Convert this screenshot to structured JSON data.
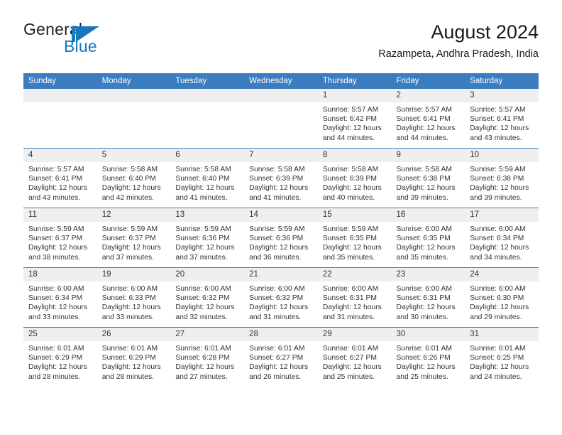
{
  "brand": {
    "name_part1": "General",
    "name_part2": "Blue",
    "mark": "flag-triangle-icon",
    "accent_color": "#1878be"
  },
  "header": {
    "title": "August 2024",
    "location": "Razampeta, Andhra Pradesh, India",
    "header_bg_color": "#3b7dbf",
    "daynum_bg_color": "#efefef"
  },
  "weekdays": [
    "Sunday",
    "Monday",
    "Tuesday",
    "Wednesday",
    "Thursday",
    "Friday",
    "Saturday"
  ],
  "weeks": [
    [
      {
        "day": "",
        "empty": true,
        "sunrise": "",
        "sunset": "",
        "daylight1": "",
        "daylight2": ""
      },
      {
        "day": "",
        "empty": true,
        "sunrise": "",
        "sunset": "",
        "daylight1": "",
        "daylight2": ""
      },
      {
        "day": "",
        "empty": true,
        "sunrise": "",
        "sunset": "",
        "daylight1": "",
        "daylight2": ""
      },
      {
        "day": "",
        "empty": true,
        "sunrise": "",
        "sunset": "",
        "daylight1": "",
        "daylight2": ""
      },
      {
        "day": "1",
        "sunrise": "Sunrise: 5:57 AM",
        "sunset": "Sunset: 6:42 PM",
        "daylight1": "Daylight: 12 hours",
        "daylight2": "and 44 minutes."
      },
      {
        "day": "2",
        "sunrise": "Sunrise: 5:57 AM",
        "sunset": "Sunset: 6:41 PM",
        "daylight1": "Daylight: 12 hours",
        "daylight2": "and 44 minutes."
      },
      {
        "day": "3",
        "sunrise": "Sunrise: 5:57 AM",
        "sunset": "Sunset: 6:41 PM",
        "daylight1": "Daylight: 12 hours",
        "daylight2": "and 43 minutes."
      }
    ],
    [
      {
        "day": "4",
        "sunrise": "Sunrise: 5:57 AM",
        "sunset": "Sunset: 6:41 PM",
        "daylight1": "Daylight: 12 hours",
        "daylight2": "and 43 minutes."
      },
      {
        "day": "5",
        "sunrise": "Sunrise: 5:58 AM",
        "sunset": "Sunset: 6:40 PM",
        "daylight1": "Daylight: 12 hours",
        "daylight2": "and 42 minutes."
      },
      {
        "day": "6",
        "sunrise": "Sunrise: 5:58 AM",
        "sunset": "Sunset: 6:40 PM",
        "daylight1": "Daylight: 12 hours",
        "daylight2": "and 41 minutes."
      },
      {
        "day": "7",
        "sunrise": "Sunrise: 5:58 AM",
        "sunset": "Sunset: 6:39 PM",
        "daylight1": "Daylight: 12 hours",
        "daylight2": "and 41 minutes."
      },
      {
        "day": "8",
        "sunrise": "Sunrise: 5:58 AM",
        "sunset": "Sunset: 6:39 PM",
        "daylight1": "Daylight: 12 hours",
        "daylight2": "and 40 minutes."
      },
      {
        "day": "9",
        "sunrise": "Sunrise: 5:58 AM",
        "sunset": "Sunset: 6:38 PM",
        "daylight1": "Daylight: 12 hours",
        "daylight2": "and 39 minutes."
      },
      {
        "day": "10",
        "sunrise": "Sunrise: 5:59 AM",
        "sunset": "Sunset: 6:38 PM",
        "daylight1": "Daylight: 12 hours",
        "daylight2": "and 39 minutes."
      }
    ],
    [
      {
        "day": "11",
        "sunrise": "Sunrise: 5:59 AM",
        "sunset": "Sunset: 6:37 PM",
        "daylight1": "Daylight: 12 hours",
        "daylight2": "and 38 minutes."
      },
      {
        "day": "12",
        "sunrise": "Sunrise: 5:59 AM",
        "sunset": "Sunset: 6:37 PM",
        "daylight1": "Daylight: 12 hours",
        "daylight2": "and 37 minutes."
      },
      {
        "day": "13",
        "sunrise": "Sunrise: 5:59 AM",
        "sunset": "Sunset: 6:36 PM",
        "daylight1": "Daylight: 12 hours",
        "daylight2": "and 37 minutes."
      },
      {
        "day": "14",
        "sunrise": "Sunrise: 5:59 AM",
        "sunset": "Sunset: 6:36 PM",
        "daylight1": "Daylight: 12 hours",
        "daylight2": "and 36 minutes."
      },
      {
        "day": "15",
        "sunrise": "Sunrise: 5:59 AM",
        "sunset": "Sunset: 6:35 PM",
        "daylight1": "Daylight: 12 hours",
        "daylight2": "and 35 minutes."
      },
      {
        "day": "16",
        "sunrise": "Sunrise: 6:00 AM",
        "sunset": "Sunset: 6:35 PM",
        "daylight1": "Daylight: 12 hours",
        "daylight2": "and 35 minutes."
      },
      {
        "day": "17",
        "sunrise": "Sunrise: 6:00 AM",
        "sunset": "Sunset: 6:34 PM",
        "daylight1": "Daylight: 12 hours",
        "daylight2": "and 34 minutes."
      }
    ],
    [
      {
        "day": "18",
        "sunrise": "Sunrise: 6:00 AM",
        "sunset": "Sunset: 6:34 PM",
        "daylight1": "Daylight: 12 hours",
        "daylight2": "and 33 minutes."
      },
      {
        "day": "19",
        "sunrise": "Sunrise: 6:00 AM",
        "sunset": "Sunset: 6:33 PM",
        "daylight1": "Daylight: 12 hours",
        "daylight2": "and 33 minutes."
      },
      {
        "day": "20",
        "sunrise": "Sunrise: 6:00 AM",
        "sunset": "Sunset: 6:32 PM",
        "daylight1": "Daylight: 12 hours",
        "daylight2": "and 32 minutes."
      },
      {
        "day": "21",
        "sunrise": "Sunrise: 6:00 AM",
        "sunset": "Sunset: 6:32 PM",
        "daylight1": "Daylight: 12 hours",
        "daylight2": "and 31 minutes."
      },
      {
        "day": "22",
        "sunrise": "Sunrise: 6:00 AM",
        "sunset": "Sunset: 6:31 PM",
        "daylight1": "Daylight: 12 hours",
        "daylight2": "and 31 minutes."
      },
      {
        "day": "23",
        "sunrise": "Sunrise: 6:00 AM",
        "sunset": "Sunset: 6:31 PM",
        "daylight1": "Daylight: 12 hours",
        "daylight2": "and 30 minutes."
      },
      {
        "day": "24",
        "sunrise": "Sunrise: 6:00 AM",
        "sunset": "Sunset: 6:30 PM",
        "daylight1": "Daylight: 12 hours",
        "daylight2": "and 29 minutes."
      }
    ],
    [
      {
        "day": "25",
        "sunrise": "Sunrise: 6:01 AM",
        "sunset": "Sunset: 6:29 PM",
        "daylight1": "Daylight: 12 hours",
        "daylight2": "and 28 minutes."
      },
      {
        "day": "26",
        "sunrise": "Sunrise: 6:01 AM",
        "sunset": "Sunset: 6:29 PM",
        "daylight1": "Daylight: 12 hours",
        "daylight2": "and 28 minutes."
      },
      {
        "day": "27",
        "sunrise": "Sunrise: 6:01 AM",
        "sunset": "Sunset: 6:28 PM",
        "daylight1": "Daylight: 12 hours",
        "daylight2": "and 27 minutes."
      },
      {
        "day": "28",
        "sunrise": "Sunrise: 6:01 AM",
        "sunset": "Sunset: 6:27 PM",
        "daylight1": "Daylight: 12 hours",
        "daylight2": "and 26 minutes."
      },
      {
        "day": "29",
        "sunrise": "Sunrise: 6:01 AM",
        "sunset": "Sunset: 6:27 PM",
        "daylight1": "Daylight: 12 hours",
        "daylight2": "and 25 minutes."
      },
      {
        "day": "30",
        "sunrise": "Sunrise: 6:01 AM",
        "sunset": "Sunset: 6:26 PM",
        "daylight1": "Daylight: 12 hours",
        "daylight2": "and 25 minutes."
      },
      {
        "day": "31",
        "sunrise": "Sunrise: 6:01 AM",
        "sunset": "Sunset: 6:25 PM",
        "daylight1": "Daylight: 12 hours",
        "daylight2": "and 24 minutes."
      }
    ]
  ]
}
